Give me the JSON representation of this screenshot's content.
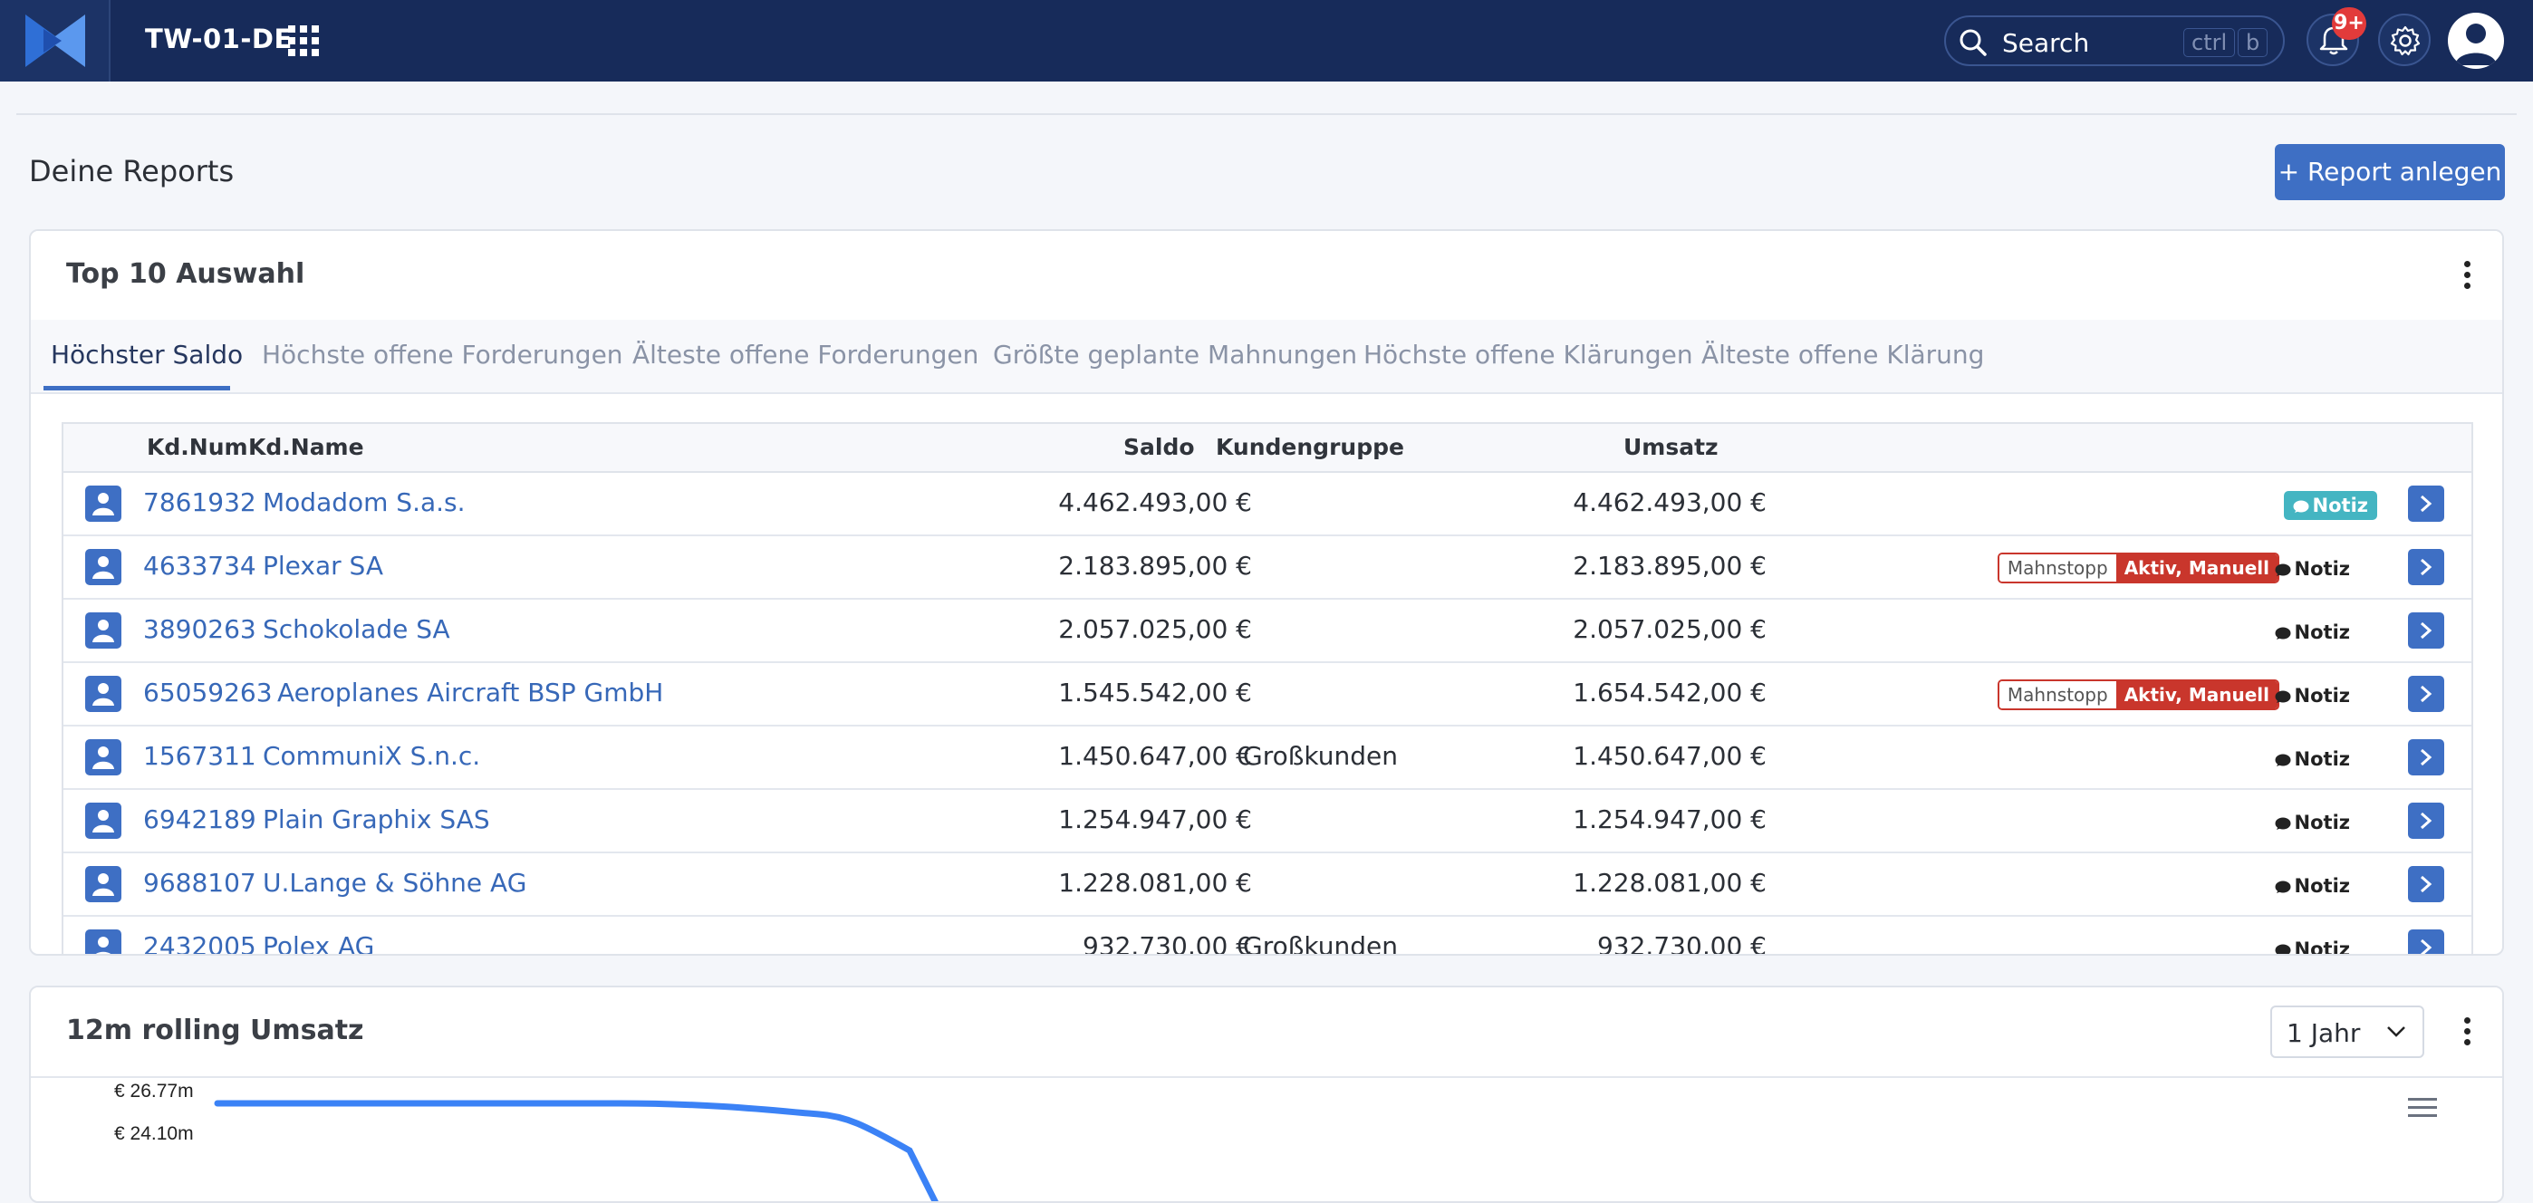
{
  "header": {
    "app_title": "TW-01-DE",
    "search_placeholder": "Search",
    "shortcut_key1": "ctrl",
    "shortcut_key2": "b",
    "notifications_badge": "9+"
  },
  "page": {
    "title": "Deine Reports",
    "add_button": "+ Report anlegen"
  },
  "top10": {
    "title": "Top 10 Auswahl",
    "tabs": [
      {
        "label": "Höchster Saldo",
        "active": true
      },
      {
        "label": "Höchste offene Forderungen"
      },
      {
        "label": "Älteste offene Forderungen"
      },
      {
        "label": "Größte geplante Mahnungen"
      },
      {
        "label": "Höchste offene Klärungen"
      },
      {
        "label": "Älteste offene Klärung"
      }
    ],
    "columns": {
      "kdnum": "Kd.Num",
      "kdname": "Kd.Name",
      "saldo": "Saldo",
      "kundengruppe": "Kundengruppe",
      "umsatz": "Umsatz"
    },
    "rows": [
      {
        "num": "7861932",
        "name": "Modadom S.a.s.",
        "saldo": "4.462.493,00 €",
        "gruppe": "",
        "umsatz": "4.462.493,00 €",
        "notiz": "Notiz",
        "mahnstopp": false
      },
      {
        "num": "4633734",
        "name": "Plexar SA",
        "saldo": "2.183.895,00 €",
        "gruppe": "",
        "umsatz": "2.183.895,00 €",
        "notiz": "Notiz",
        "mahnstopp": true
      },
      {
        "num": "3890263",
        "name": "Schokolade SA",
        "saldo": "2.057.025,00 €",
        "gruppe": "",
        "umsatz": "2.057.025,00 €",
        "notiz": "Notiz",
        "mahnstopp": false
      },
      {
        "num": "65059263",
        "name": "Aeroplanes Aircraft BSP GmbH",
        "saldo": "1.545.542,00 €",
        "gruppe": "",
        "umsatz": "1.654.542,00 €",
        "notiz": "Notiz",
        "mahnstopp": true
      },
      {
        "num": "1567311",
        "name": "CommuniX S.n.c.",
        "saldo": "1.450.647,00 €",
        "gruppe": "Großkunden",
        "umsatz": "1.450.647,00 €",
        "notiz": "Notiz",
        "mahnstopp": false
      },
      {
        "num": "6942189",
        "name": "Plain Graphix SAS",
        "saldo": "1.254.947,00 €",
        "gruppe": "",
        "umsatz": "1.254.947,00 €",
        "notiz": "Notiz",
        "mahnstopp": false
      },
      {
        "num": "9688107",
        "name": "U.Lange & Söhne AG",
        "saldo": "1.228.081,00 €",
        "gruppe": "",
        "umsatz": "1.228.081,00 €",
        "notiz": "Notiz",
        "mahnstopp": false
      },
      {
        "num": "2432005",
        "name": "Polex AG",
        "saldo": "932.730,00 €",
        "gruppe": "Großkunden",
        "umsatz": "932.730,00 €",
        "notiz": "Notiz",
        "mahnstopp": false
      }
    ],
    "mahnstopp_label": "Mahnstopp",
    "mahnstopp_status": "Aktiv, Manuell"
  },
  "rolling": {
    "title": "12m rolling Umsatz",
    "period_select": "1 Jahr",
    "y_ticks": [
      "€ 26.77m",
      "€ 24.10m"
    ],
    "line_color": "#3b82f6"
  },
  "colors": {
    "header_bg": "#172b5a",
    "accent": "#3e6fc4",
    "danger": "#c9362c",
    "notiz_filled": "#44b5c2"
  }
}
